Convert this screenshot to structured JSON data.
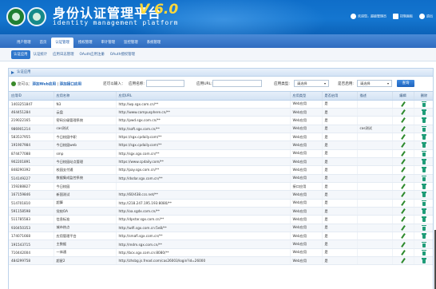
{
  "header": {
    "title_cn": "身份认证管理平台",
    "version": "V 6.0",
    "title_en": "identity management platform",
    "user_links": [
      "欢迎您，超级管理员",
      "控制面板",
      "退出"
    ],
    "colors": {
      "accent": "#1476d0",
      "version": "#ffd83a"
    }
  },
  "topmenu": {
    "items": [
      "用户管理",
      "首页",
      "认证管理",
      "授权管理",
      "审计管理",
      "监控管理",
      "系统管理"
    ],
    "active_index": 2
  },
  "submenu": {
    "items": [
      "认证应用",
      "认证统计",
      "应用日志管理",
      "OAuth应用注册",
      "OAuth授权管理"
    ],
    "active_index": 0
  },
  "panel": {
    "title": "认证应用"
  },
  "toolbar": {
    "location_prefix": "您可以：",
    "action_add_web": "添加Web应用",
    "separator": " | ",
    "action_add_api": "添加接口应用",
    "search_prompt": "还可以输入：",
    "app_name_label": "应用名称:",
    "app_name_value": "",
    "app_url_label": "应用URL:",
    "app_url_value": "",
    "app_type_label": "应用类型:",
    "app_type_value": "请选择",
    "enabled_label": "是否启用:",
    "enabled_value": "请选择",
    "query_button": "查询"
  },
  "table": {
    "columns": [
      "应用ID",
      "应用名称",
      "应用URL",
      "应用类型",
      "是否启用",
      "描述",
      "编辑",
      "删除"
    ],
    "rows": [
      [
        "1403251847",
        "N3",
        "http://wp.sgx.com.cn/**",
        "Web应用",
        "是",
        ""
      ],
      [
        "464451284",
        "云盘",
        "http://www.campusphere.cn/**",
        "Web应用",
        "是",
        ""
      ],
      [
        "219022165",
        "密码分级管理系统",
        "http://pwd.sgx.com.cn/**",
        "Web应用",
        "是",
        ""
      ],
      [
        "986901214",
        "cas测试",
        "http://soft.sgx.com.cn/**",
        "Web应用",
        "是",
        "cas测试"
      ],
      [
        "583537955",
        "今日校园中职",
        "https://sgx.cpdaily.com/**",
        "Web应用",
        "是",
        ""
      ],
      [
        "191907984",
        "今日校园web",
        "https://sgx.cpdaily.com/**",
        "Web应用",
        "是",
        ""
      ],
      [
        "874477088",
        "smp",
        "http://sgx.sgx.com.cn/**",
        "Web应用",
        "是",
        ""
      ],
      [
        "902201891",
        "今日校园站点管理",
        "https://www.cpdaily.com/**",
        "Web应用",
        "是",
        ""
      ],
      [
        "848290392",
        "校园支付通",
        "http://pay.sgx.com.cn/**",
        "Web应用",
        "是",
        ""
      ],
      [
        "514149227",
        "数据集成监控系统",
        "http://dsdar.sgx.com.cn/**",
        "Web应用",
        "是",
        ""
      ],
      [
        "159288827",
        "今日校园",
        "",
        "接口应用",
        "是",
        ""
      ],
      [
        "167159846",
        "新国测试",
        "http://60/438.ccs.net/**",
        "Web应用",
        "是",
        ""
      ],
      [
        "514701810",
        "超算",
        "http://218.247.195.193:8080/**",
        "Web应用",
        "是",
        ""
      ],
      [
        "591158598",
        "党校OA",
        "http://oa.sgdx.com.cn/**",
        "Web应用",
        "是",
        ""
      ],
      [
        "511785583",
        "信息标准",
        "http://dpstar.sgx.com.cn/**",
        "Web应用",
        "是",
        ""
      ],
      [
        "930450353",
        "城市热点",
        "http://wifi.sgx.com.cn:5e8/**",
        "Web应用",
        "是",
        ""
      ],
      [
        "174071668",
        "应用管理平台",
        "http://smafi.sgx.com.cn/**",
        "Web应用",
        "是",
        ""
      ],
      [
        "191543715",
        "主数据",
        "http://mdm.sgx.com.cn/**",
        "Web应用",
        "是",
        ""
      ],
      [
        "710442004",
        "一体通",
        "http://bcx.sgx.com.cn:8080/**",
        "Web应用",
        "是",
        ""
      ],
      [
        "484299758",
        "超星2",
        "http://zhsbg.js.fread.com/cas26003/login?id=26000",
        "Web应用",
        "是",
        ""
      ]
    ]
  }
}
